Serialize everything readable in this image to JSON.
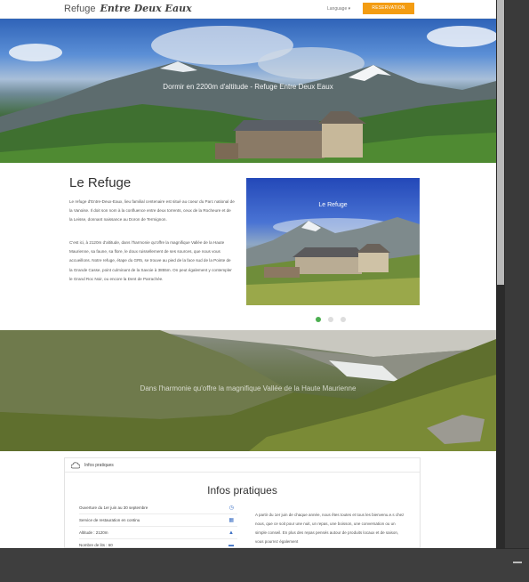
{
  "nav": {
    "brand_plain": "Refuge",
    "brand_script": "Entre Deux Eaux",
    "language": "Language ▾",
    "reserve_label": "RESERVATION"
  },
  "hero": {
    "caption": "Dormir en 2200m d'altitude - Refuge Entre Deux Eaux"
  },
  "refuge": {
    "title": "Le Refuge",
    "p1": "Le refuge d'Entre-Deux-Eaux, lieu familial centenaire est situé au coeur du Parc national de la Vanoise. Il doit son nom à la confluence entre deux torrents, ceux de la Rocheure et de la Leisse, donnant naissance au Doron de Termignon.",
    "p2": "C'est ici, à 2120m d'altitude, dans l'harmonie qu'offre la magnifique Vallée de la Haute Maurienne, sa faune, sa flore, le doux ruissellement de ses sources, que nous vous accueillons. Notre refuge, étape du GR5, se trouve au pied de la face sud de la Pointe de la Grande Casse, point culminant de la Savoie à 3855m. On peut également y contempler le Grand Roc Noir, ou encore la Dent de Parrachée.",
    "slide_caption": "Le Refuge"
  },
  "valley": {
    "caption": "Dans l'harmonie qu'offre la magnifique Vallée de la Haute Maurienne"
  },
  "infos": {
    "tab_label": "Infos pratiques",
    "title": "Infos pratiques",
    "rows": [
      {
        "label": "Ouverture du 1er juin au 30 septembre",
        "icon": "clock-icon"
      },
      {
        "label": "Service de restauration en continu",
        "icon": "restaurant-icon"
      },
      {
        "label": "Altitude : 2120m",
        "icon": "mountain-icon"
      },
      {
        "label": "Nombre de lits : 60",
        "icon": "bed-icon"
      }
    ],
    "text": "A partir du 1er juin de chaque année, nous êtes toutes et tous les bienvenu.e.s chez nous, que ce soit pour une nuit, un repas, une boisson, une conversation ou un simple conseil. En plus des repas pensés autour de produits locaux et de saison, vous pourrez également"
  },
  "colors": {
    "accent": "#f39c12",
    "dot_active": "#4caf50",
    "icon_blue": "#3b6fc4"
  }
}
